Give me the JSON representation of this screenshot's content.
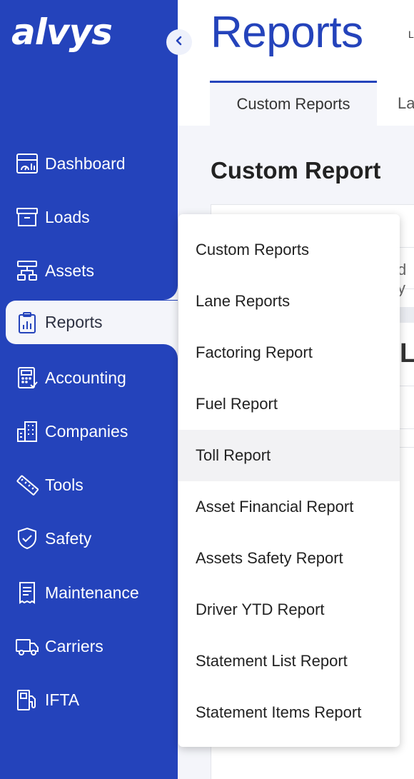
{
  "app": {
    "logo_text": "alvys"
  },
  "sidebar": {
    "items": [
      {
        "label": "Dashboard",
        "icon": "dashboard-icon"
      },
      {
        "label": "Loads",
        "icon": "box-icon"
      },
      {
        "label": "Assets",
        "icon": "network-icon"
      },
      {
        "label": "Reports",
        "icon": "clipboard-chart-icon",
        "active": true
      },
      {
        "label": "Accounting",
        "icon": "calculator-icon"
      },
      {
        "label": "Companies",
        "icon": "buildings-icon"
      },
      {
        "label": "Tools",
        "icon": "ruler-icon"
      },
      {
        "label": "Safety",
        "icon": "shield-check-icon"
      },
      {
        "label": "Maintenance",
        "icon": "receipt-icon"
      },
      {
        "label": "Carriers",
        "icon": "truck-icon"
      },
      {
        "label": "IFTA",
        "icon": "fuel-pump-icon"
      }
    ]
  },
  "header": {
    "title": "Reports",
    "right_fragment": "L"
  },
  "tabs": [
    {
      "label": "Custom Reports",
      "active": true
    },
    {
      "label": "La"
    }
  ],
  "main": {
    "section_title": "Custom Report",
    "fragment_1": "d y",
    "fragment_2": "L"
  },
  "dropdown": {
    "items": [
      {
        "label": "Custom Reports"
      },
      {
        "label": "Lane Reports"
      },
      {
        "label": "Factoring Report"
      },
      {
        "label": "Fuel Report"
      },
      {
        "label": "Toll Report",
        "hover": true
      },
      {
        "label": "Asset Financial Report"
      },
      {
        "label": "Assets Safety Report"
      },
      {
        "label": "Driver YTD Report"
      },
      {
        "label": "Statement List Report"
      },
      {
        "label": "Statement Items Report"
      }
    ]
  },
  "colors": {
    "brand_blue": "#2443bb",
    "page_bg": "#f4f5fa",
    "hover_bg": "#f2f2f4"
  }
}
